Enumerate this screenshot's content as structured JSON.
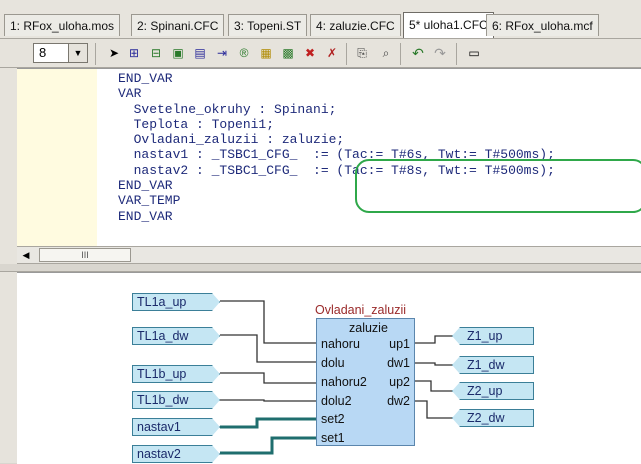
{
  "tabs": [
    {
      "label": "1: RFox_uloha.mos",
      "active": false
    },
    {
      "label": "2: Spinani.CFC",
      "active": false
    },
    {
      "label": "3: Topeni.ST",
      "active": false
    },
    {
      "label": "4: zaluzie.CFC",
      "active": false
    },
    {
      "label": "5* uloha1.CFC",
      "active": true
    },
    {
      "label": "6: RFox_uloha.mcf",
      "active": false
    }
  ],
  "toolbar": {
    "zoom_value": "8"
  },
  "code_lines": [
    "END_VAR",
    "VAR",
    "  Svetelne_okruhy : Spinani;",
    "  Teplota : Topeni1;",
    "  Ovladani_zaluzii : zaluzie;",
    "  nastav1 : _TSBC1_CFG_  := (Tac:= T#6s, Twt:= T#500ms);",
    "  nastav2 : _TSBC1_CFG_  := (Tac:= T#8s, Twt:= T#500ms);",
    "END_VAR",
    "VAR_TEMP",
    "END_VAR"
  ],
  "scroll_thumb": "III",
  "diagram": {
    "block_instance": "Ovladani_zaluzii",
    "block_type": "zaluzie",
    "inputs": [
      "nahoru",
      "dolu",
      "nahoru2",
      "dolu2",
      "set2",
      "set1"
    ],
    "outputs": [
      "up1",
      "dw1",
      "up2",
      "dw2"
    ],
    "input_pins": [
      "TL1a_up",
      "TL1a_dw",
      "TL1b_up",
      "TL1b_dw",
      "nastav1",
      "nastav2"
    ],
    "output_pins": [
      "Z1_up",
      "Z1_dw",
      "Z2_up",
      "Z2_dw"
    ]
  },
  "colors": {
    "highlight": "#2fa84a",
    "code": "#1e2a7a",
    "pin_fill": "#c5e6f3",
    "block_fill": "#b8d8f4"
  }
}
